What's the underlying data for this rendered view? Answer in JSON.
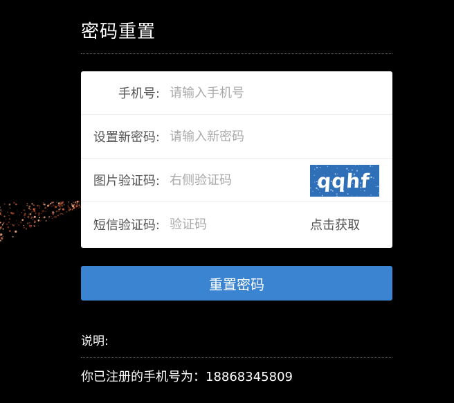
{
  "page": {
    "title": "密码重置"
  },
  "form": {
    "phone": {
      "label": "手机号:",
      "placeholder": "请输入手机号",
      "value": ""
    },
    "new_password": {
      "label": "设置新密码:",
      "placeholder": "请输入新密码",
      "value": ""
    },
    "image_code": {
      "label": "图片验证码:",
      "placeholder": "右侧验证码",
      "value": "",
      "captcha_text": "qqhf"
    },
    "sms_code": {
      "label": "短信验证码:",
      "placeholder": "验证码",
      "value": "",
      "get_code_label": "点击获取"
    }
  },
  "actions": {
    "submit_label": "重置密码"
  },
  "notes": {
    "label": "说明:",
    "registered_phone_text": "你已注册的手机号为：18868345809"
  },
  "colors": {
    "background": "#000000",
    "primary_button": "#3a84d1",
    "captcha_bg": "#2f6fb8"
  }
}
